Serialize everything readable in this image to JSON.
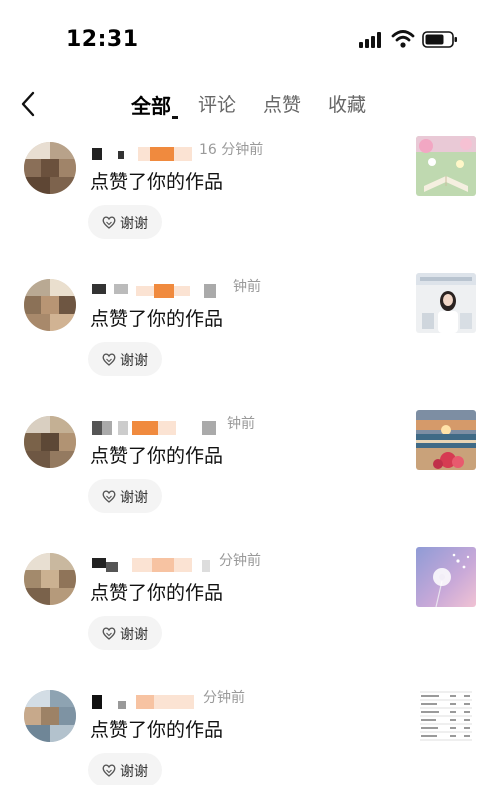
{
  "status": {
    "time": "12:31"
  },
  "tabs": [
    {
      "label": "全部",
      "active": true
    },
    {
      "label": "评论",
      "active": false
    },
    {
      "label": "点赞",
      "active": false
    },
    {
      "label": "收藏",
      "active": false
    }
  ],
  "items": [
    {
      "time": "16 分钟前",
      "action": "点赞了你的作品",
      "thanks_label": "谢谢",
      "thumbnail": "book-flowers-photo"
    },
    {
      "time": "钟前",
      "action": "点赞了你的作品",
      "thanks_label": "谢谢",
      "thumbnail": "girl-portrait-photo"
    },
    {
      "time": "钟前",
      "action": "点赞了你的作品",
      "thanks_label": "谢谢",
      "thumbnail": "sunset-sea-photo"
    },
    {
      "time": "分钟前",
      "action": "点赞了你的作品",
      "thanks_label": "谢谢",
      "thumbnail": "dandelion-photo"
    },
    {
      "time": "分钟前",
      "action": "点赞了你的作品",
      "thanks_label": "谢谢",
      "thumbnail": "table-document-photo"
    }
  ],
  "colors": {
    "orange_mosaic": "#f08a3e",
    "chip_bg": "#f4f4f4",
    "time_gray": "#9a9a9a"
  }
}
